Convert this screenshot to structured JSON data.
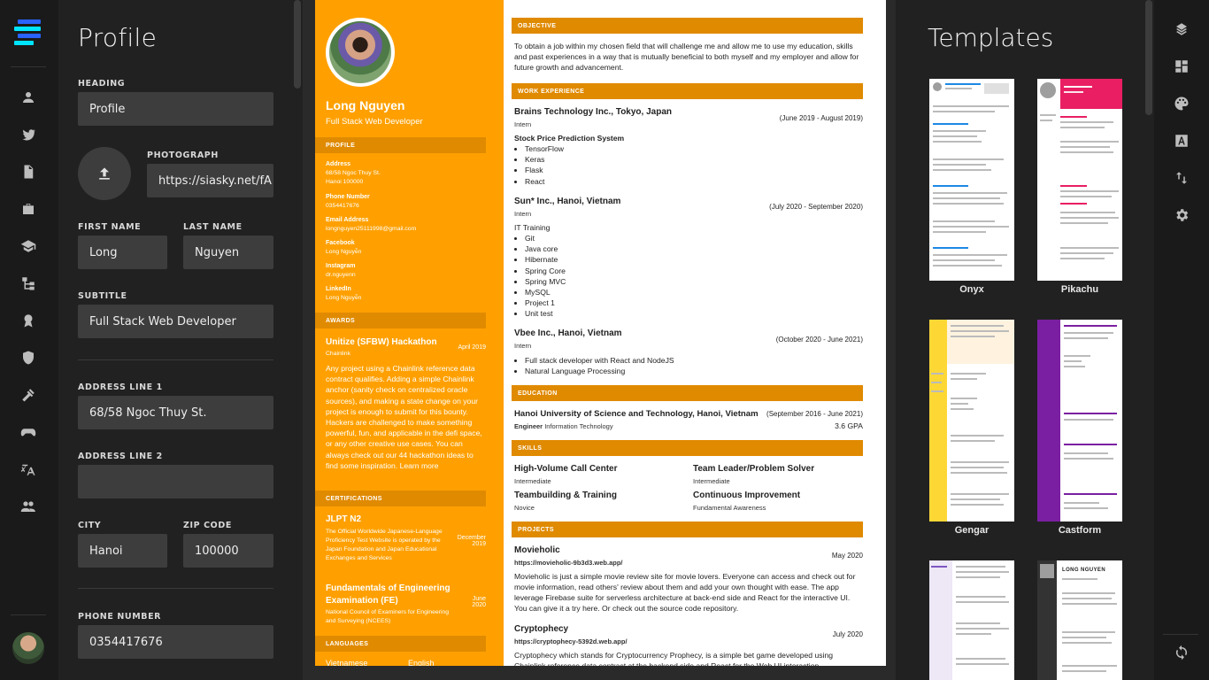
{
  "left_panel": {
    "title": "Profile",
    "heading_label": "HEADING",
    "heading_value": "Profile",
    "photo_label": "PHOTOGRAPH",
    "photo_value": "https://siasky.net/fA",
    "first_name_label": "FIRST NAME",
    "first_name_value": "Long",
    "last_name_label": "LAST NAME",
    "last_name_value": "Nguyen",
    "subtitle_label": "SUBTITLE",
    "subtitle_value": "Full Stack Web Developer",
    "address1_label": "ADDRESS LINE 1",
    "address1_value": "68/58 Ngoc Thuy St.",
    "address2_label": "ADDRESS LINE 2",
    "address2_value": "",
    "city_label": "CITY",
    "city_value": "Hanoi",
    "zip_label": "ZIP CODE",
    "zip_value": "100000",
    "phone_label": "PHONE NUMBER",
    "phone_value": "0354417676"
  },
  "left_nav": [
    "user-icon",
    "twitter-icon",
    "document-icon",
    "briefcase-icon",
    "graduation-icon",
    "tree-icon",
    "award-icon",
    "shield-icon",
    "tools-icon",
    "gamepad-icon",
    "translate-icon",
    "people-icon"
  ],
  "right_nav": [
    "layers-icon",
    "dashboard-icon",
    "palette-icon",
    "font-icon",
    "sort-icon",
    "gear-icon",
    "sync-icon"
  ],
  "resume": {
    "name": "Long Nguyen",
    "subtitle": "Full Stack Web Developer",
    "profile_head": "PROFILE",
    "address_label": "Address",
    "address_l1": "68/58 Ngoc Thuy St.",
    "address_l2": "Hanoi 100000",
    "phone_label": "Phone Number",
    "phone": "0354417676",
    "email_label": "Email Address",
    "email": "longnguyen25111998@gmail.com",
    "facebook_label": "Facebook",
    "facebook": "Long Nguyễn",
    "instagram_label": "Instagram",
    "instagram": "dr.nguyenn",
    "linkedin_label": "LinkedIn",
    "linkedin": "Long Nguyễn",
    "awards_head": "AWARDS",
    "award_title": "Unitize (SFBW) Hackathon",
    "award_date": "April 2019",
    "award_org": "Chainlink",
    "award_body": "Any project using a Chainlink reference data contract qualifies. Adding a simple Chainlink anchor (sanity check on centralized oracle sources), and making a state change on your project is enough to submit for this bounty. Hackers are challenged to make something powerful, fun, and applicable in the defi space, or any other creative use cases. You can always check out our 44 hackathon ideas to find some inspiration. Learn more",
    "cert_head": "CERTIFICATIONS",
    "cert1_title": "JLPT N2",
    "cert1_date": "December 2019",
    "cert1_body": "The Official Worldwide Japanese-Language Proficiency Test Website is operated by the Japan Foundation and Japan Educational Exchanges and Services",
    "cert2_title": "Fundamentals of Engineering Examination (FE)",
    "cert2_date": "June 2020",
    "cert2_body": "National Council of Examiners for Engineering and Surveying (NCEES)",
    "lang_head": "LANGUAGES",
    "lang1": "Vietnamese",
    "lang2": "English",
    "objective_head": "OBJECTIVE",
    "objective": "To obtain a job within my chosen field that will challenge me and allow me to use my education, skills and past experiences in a way that is mutually beneficial to both myself and my employer and allow for future growth and advancement.",
    "work_head": "WORK EXPERIENCE",
    "job1_company": "Brains Technology Inc., Tokyo, Japan",
    "job1_date": "(June 2019 - August 2019)",
    "job1_role": "Intern",
    "job1_project": "Stock Price Prediction System",
    "job1_items": [
      "TensorFlow",
      "Keras",
      "Flask",
      "React"
    ],
    "job2_company": "Sun* Inc., Hanoi, Vietnam",
    "job2_date": "(July 2020 - September 2020)",
    "job2_role": "Intern",
    "job2_project": "IT Training",
    "job2_items": [
      "Git",
      "Java core",
      "Hibernate",
      "Spring Core",
      "Spring MVC",
      "MySQL",
      "Project 1",
      "Unit test"
    ],
    "job3_company": "Vbee Inc., Hanoi, Vietnam",
    "job3_date": "(October 2020 - June 2021)",
    "job3_role": "Intern",
    "job3_items": [
      "Full stack developer with React and NodeJS",
      "Natural Language Processing"
    ],
    "edu_head": "EDUCATION",
    "edu_school": "Hanoi University of Science and Technology, Hanoi, Vietnam",
    "edu_date": "(September 2016 - June 2021)",
    "edu_degree": "Engineer",
    "edu_major": "Information Technology",
    "edu_gpa": "3.6 GPA",
    "skills_head": "SKILLS",
    "skills": [
      {
        "name": "High-Volume Call Center",
        "level": "Intermediate"
      },
      {
        "name": "Team Leader/Problem Solver",
        "level": "Intermediate"
      },
      {
        "name": "Teambuilding & Training",
        "level": "Novice"
      },
      {
        "name": "Continuous Improvement",
        "level": "Fundamental Awareness"
      }
    ],
    "projects_head": "PROJECTS",
    "proj1_title": "Movieholic",
    "proj1_url": "https://movieholic-9b3d3.web.app/",
    "proj1_date": "May 2020",
    "proj1_body": "Movieholic is just a simple movie review site for movie lovers. Everyone can access and check out for movie information, read others' review about them and add your own thought with ease. The app leverage Firebase suite for serverless architecture at back-end side and React for the interactive UI. You can give it a try here. Or check out the source code repository.",
    "proj2_title": "Cryptophecy",
    "proj2_url": "https://cryptophecy-5392d.web.app/",
    "proj2_date": "July 2020",
    "proj2_body": "Cryptophecy which stands for Cryptocurrency Prophecy, is a simple bet game developed using Chainlink reference data contract at the backend side and React for the Web UI interaction."
  },
  "templates": {
    "title": "Templates",
    "items": [
      {
        "name": "Onyx",
        "accent": "#1e88e5"
      },
      {
        "name": "Pikachu",
        "accent": "#e91e63"
      },
      {
        "name": "Gengar",
        "accent": "#fbc02d"
      },
      {
        "name": "Castform",
        "accent": "#7b1fa2"
      },
      {
        "name": "",
        "accent": "#7e57c2"
      },
      {
        "name": "",
        "accent": "#333333"
      }
    ],
    "t6_name": "LONG NGUYEN"
  },
  "colors": {
    "primary": "#ffa000",
    "primary_dark": "#e08a00",
    "panel": "#212121",
    "nav": "#1a1a1a"
  }
}
